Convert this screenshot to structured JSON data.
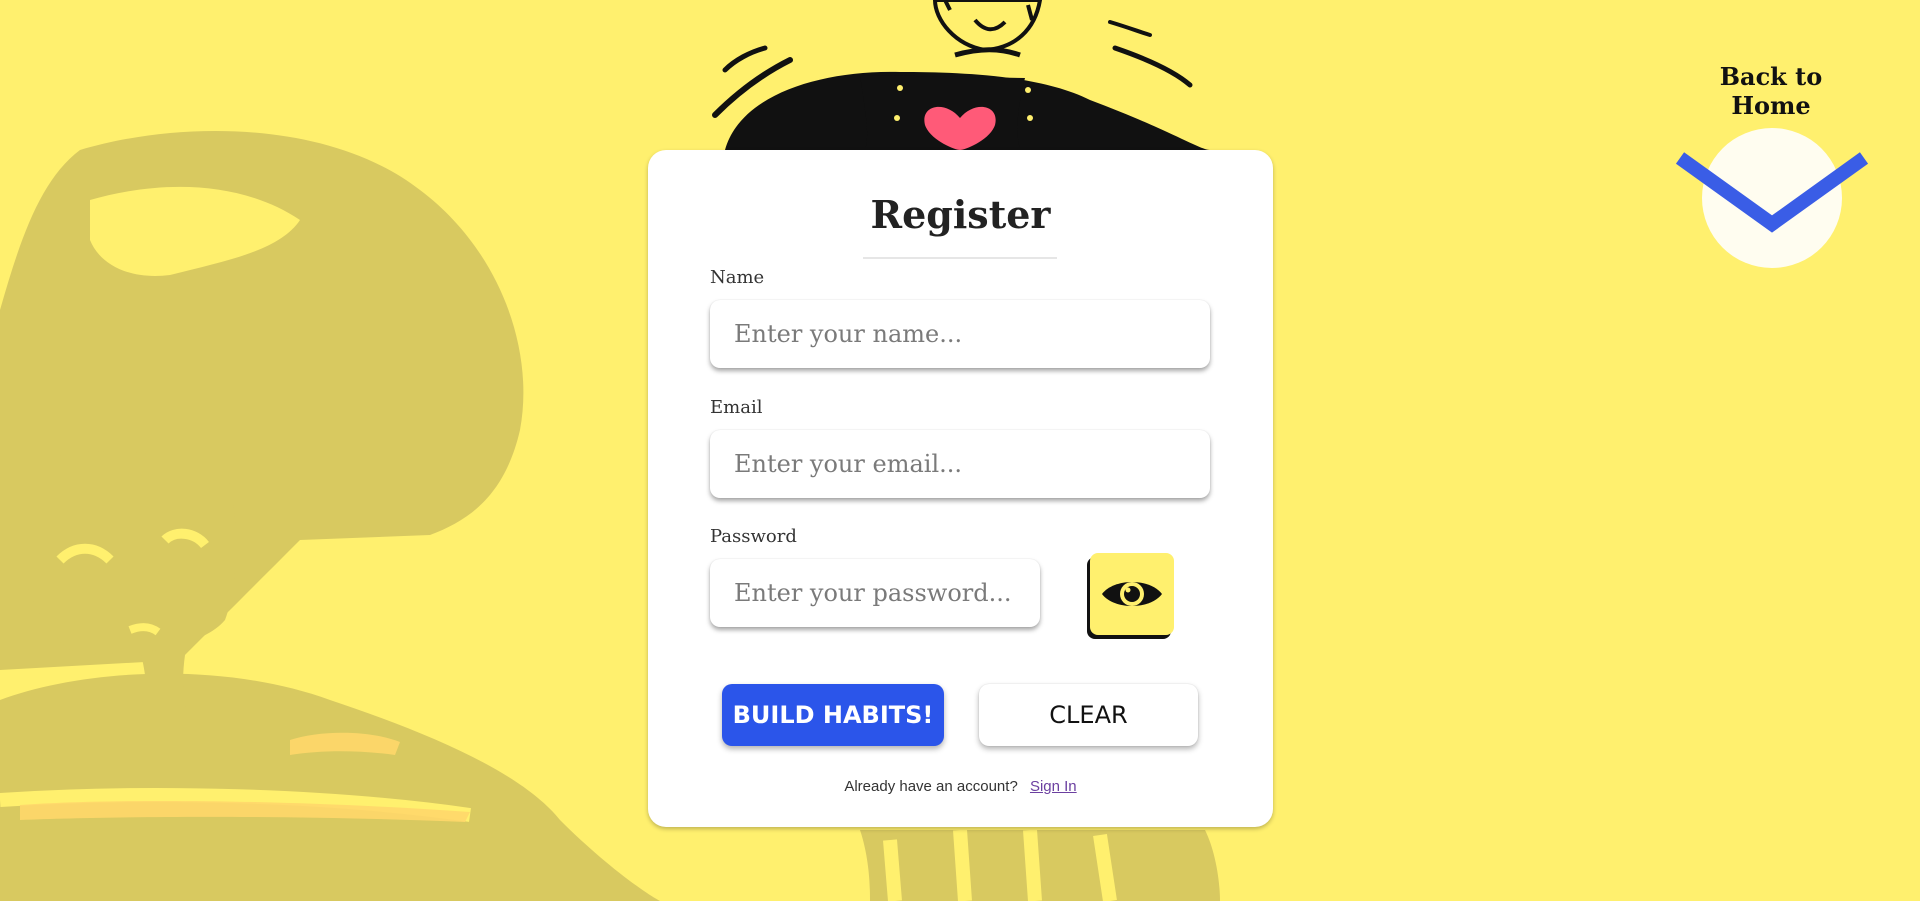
{
  "header": {
    "back_home_label": "Back to Home",
    "toggle_icon": "chevron-down-icon"
  },
  "form": {
    "title": "Register",
    "name": {
      "label": "Name",
      "placeholder": "Enter your name..."
    },
    "email": {
      "label": "Email",
      "placeholder": "Enter your email..."
    },
    "password": {
      "label": "Password",
      "placeholder": "Enter your password...",
      "toggle_icon": "eye-icon"
    },
    "submit_label": "BUILD HABITS!",
    "clear_label": "CLEAR",
    "signin_prompt": "Already have an account?",
    "signin_link": "Sign In"
  },
  "colors": {
    "background": "#fff06e",
    "art_shade": "#d8c960",
    "primary": "#2b55ea",
    "heart": "#ff5a78",
    "chevron": "#3a5de6",
    "link": "#6b3fa0"
  }
}
